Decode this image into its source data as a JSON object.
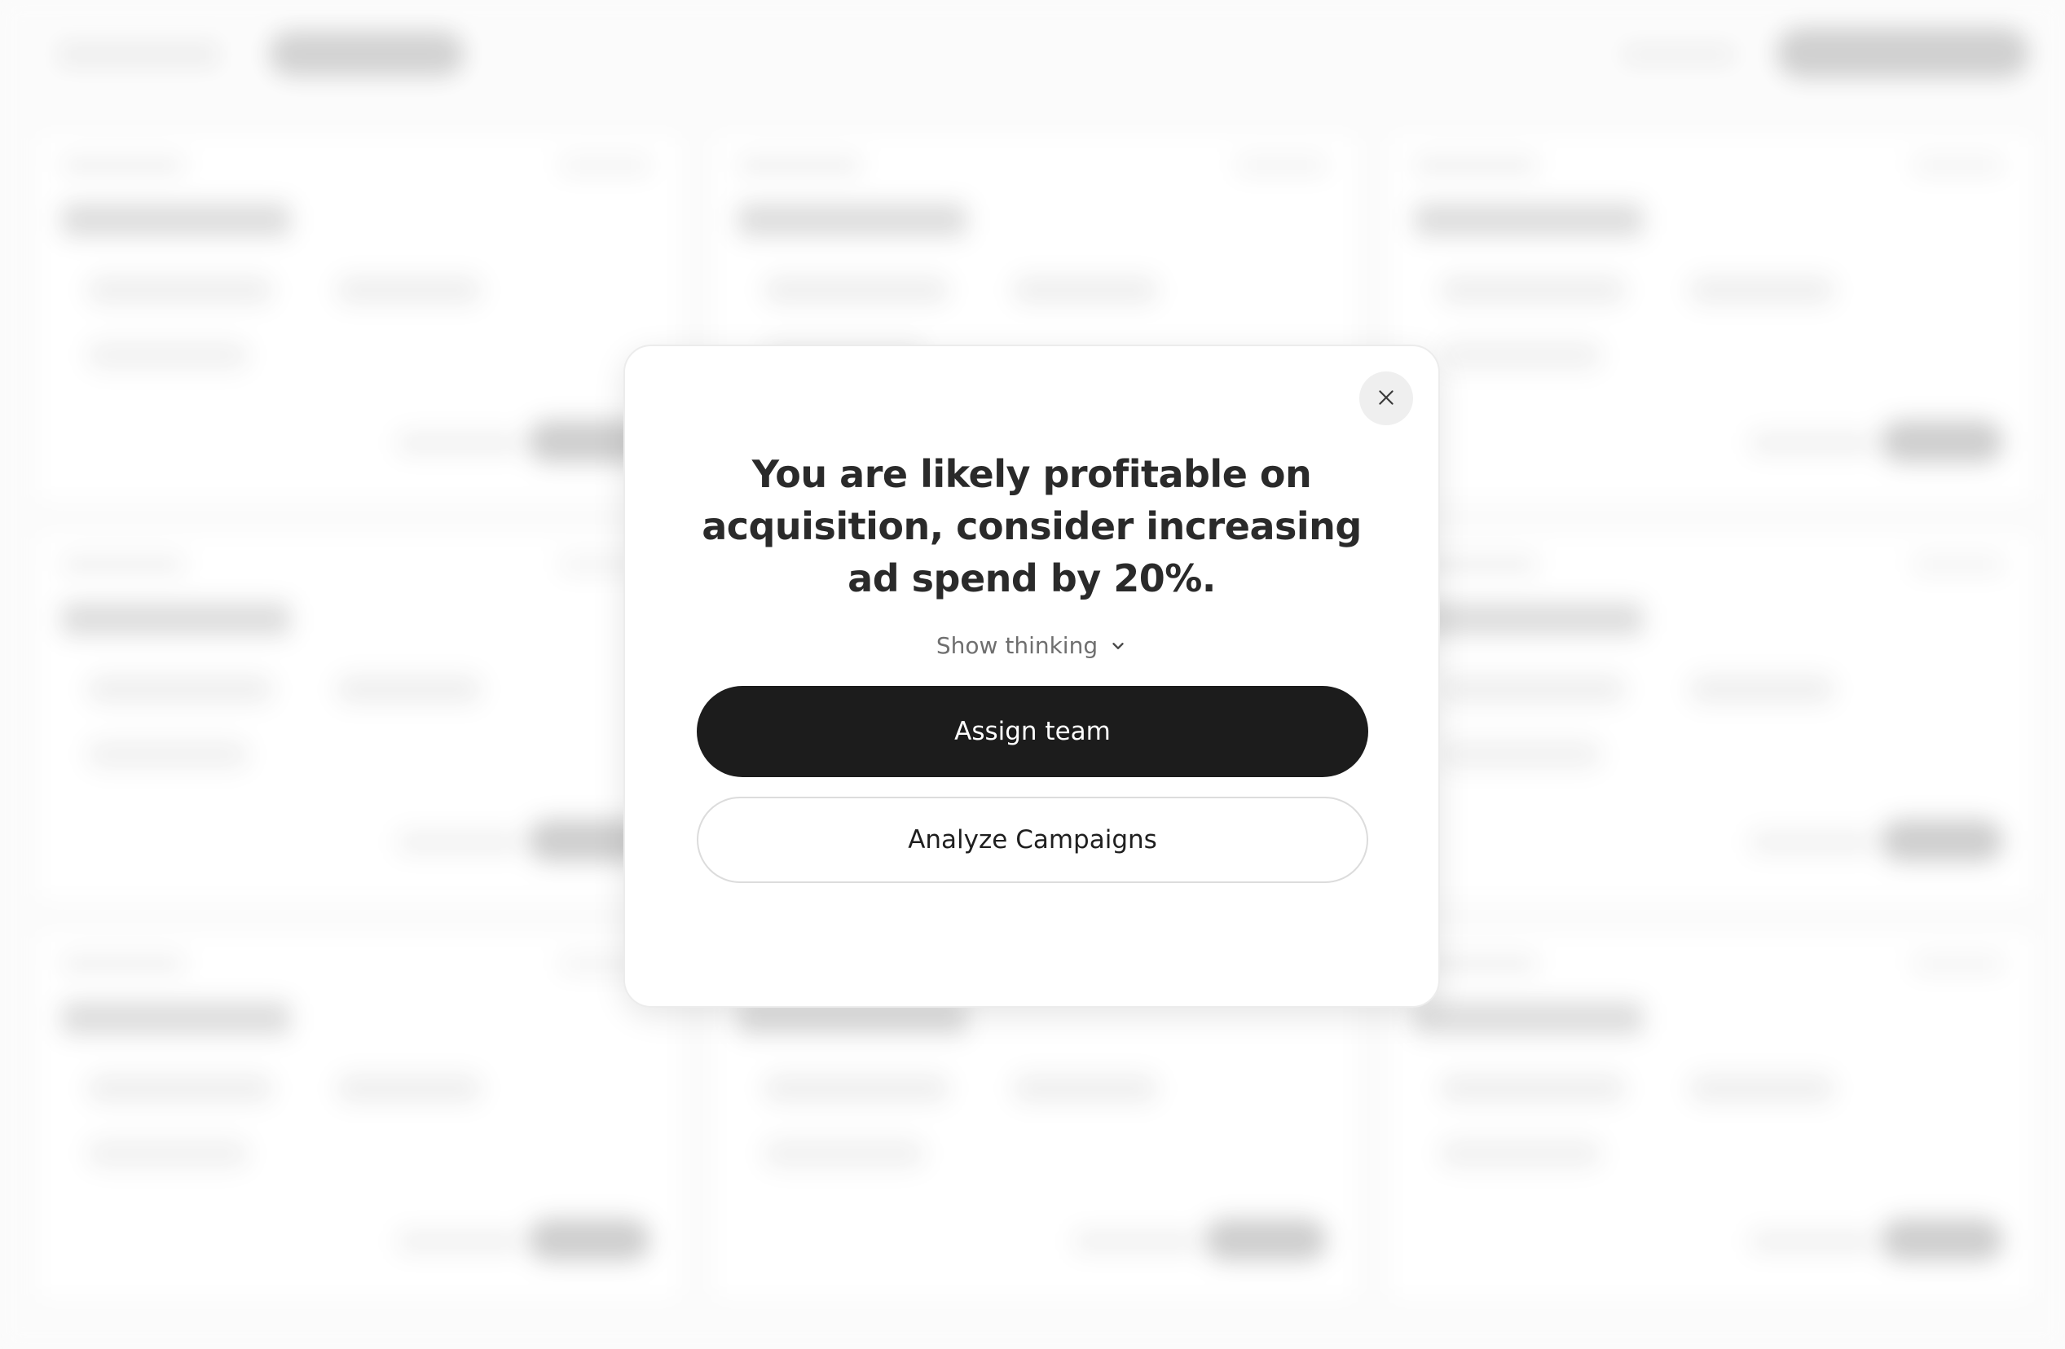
{
  "modal": {
    "title": "You are likely profitable on acquisition, consider increasing ad spend by 20%.",
    "show_thinking_label": "Show thinking",
    "primary_action": "Assign team",
    "secondary_action": "Analyze Campaigns",
    "close_icon": "close-icon",
    "chevron_icon": "chevron-down-icon"
  },
  "colors": {
    "primary_button": "#1c1c1c",
    "title_text": "#2a2a2a",
    "muted_text": "#6f6f6f"
  }
}
